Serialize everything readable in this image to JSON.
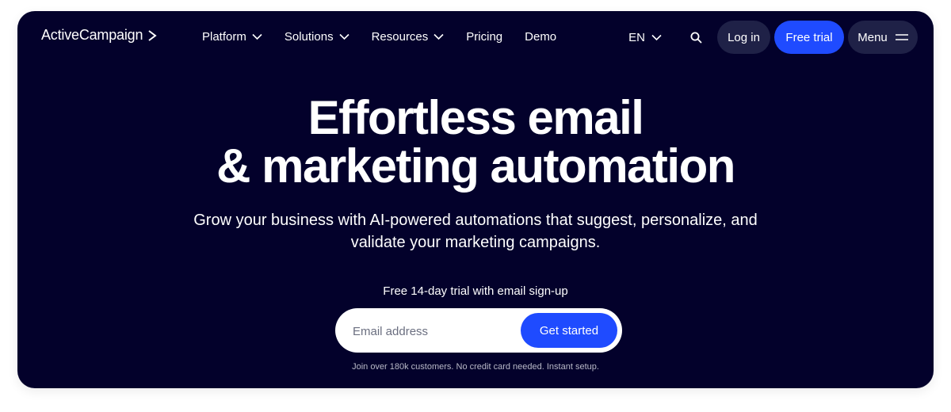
{
  "nav": {
    "brand": "ActiveCampaign",
    "links": [
      {
        "label": "Platform",
        "has_dropdown": true
      },
      {
        "label": "Solutions",
        "has_dropdown": true
      },
      {
        "label": "Resources",
        "has_dropdown": true
      },
      {
        "label": "Pricing",
        "has_dropdown": false
      },
      {
        "label": "Demo",
        "has_dropdown": false
      }
    ],
    "language": "EN",
    "search_icon": "search-icon",
    "login_label": "Log in",
    "trial_label": "Free trial",
    "menu_label": "Menu"
  },
  "hero": {
    "title_line1": "Effortless email",
    "title_line2": "& marketing automation",
    "subtitle": "Grow your business with AI-powered automations that suggest, personalize, and validate your marketing campaigns.",
    "trial_note": "Free 14-day trial with email sign-up",
    "email_placeholder": "Email address",
    "cta_label": "Get started",
    "fineprint": "Join over 180k customers. No credit card needed. Instant setup."
  },
  "colors": {
    "background": "#03012b",
    "accent": "#1f4bff",
    "pill_dark": "#1f2147"
  }
}
